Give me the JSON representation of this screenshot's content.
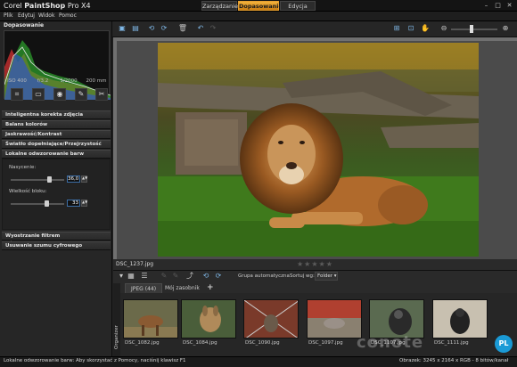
{
  "app": {
    "title_prefix": "Corel ",
    "title_bold": "PaintShop",
    "title_suffix": " Pro X4"
  },
  "modes": [
    {
      "label": "Zarządzanie"
    },
    {
      "label": "Dopasowanie"
    },
    {
      "label": "Edycja"
    }
  ],
  "menu": [
    "Plik",
    "Edytuj",
    "Widok",
    "Pomoc"
  ],
  "panel": {
    "title": "Dopasowanie",
    "exif": [
      "ISO 400",
      "f/3.2",
      "1/2000",
      "200 mm"
    ],
    "sections": [
      "Inteligentna korekta zdjęcia",
      "Balans kolorów",
      "Jaskrawość/Kontrast",
      "Światło dopełniające/Przejrzystość",
      "Lokalne odwzorowanie barw"
    ],
    "nasycenie_label": "Nasycenie:",
    "nasycenie_value": "36,0",
    "nasycenie_level": 0.36,
    "wielkosc_label": "Wielkość bloku:",
    "wielkosc_value": "33",
    "wielkosc_level": 0.33,
    "lower_sections": [
      "Wyostrzanie filtrem górnoprzepustowym",
      "Usuwanie szumu cyfrowego"
    ]
  },
  "file": {
    "name": "DSC_1237.jpg"
  },
  "organizer": {
    "group_label": "Grupa automatyczna",
    "sort_label": "Sortuj wg:",
    "sort_value": "Folder",
    "tabs": [
      "JPEG (44)",
      "Mój zasobnik"
    ],
    "add_tab": "+",
    "vertical_label": "Organizer",
    "thumbs": [
      "DSC_1082.jpg",
      "DSC_1084.jpg",
      "DSC_1090.jpg",
      "DSC_1097.jpg",
      "DSC_1107.jpg",
      "DSC_1111.jpg"
    ]
  },
  "status": {
    "left": "Lokalne odwzorowanie barw: Aby skorzystać z Pomocy, naciśnij klawisz F1",
    "right": "Obrazek: 3245 x 2164 x RGB - 8 bitów/kanał"
  },
  "watermark": "conote",
  "badge": "PL"
}
